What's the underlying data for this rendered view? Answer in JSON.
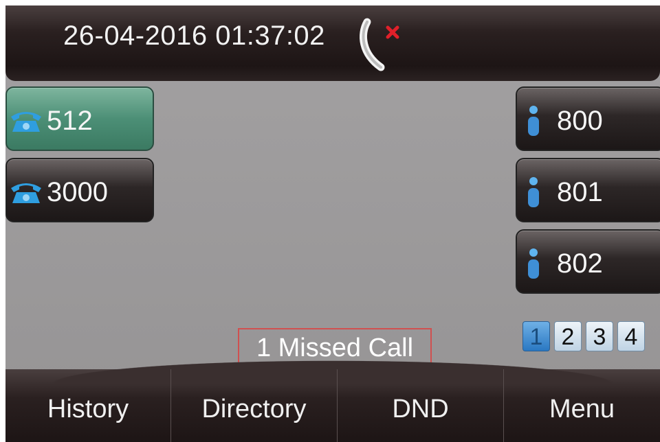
{
  "status_bar": {
    "datetime": "26-04-2016 01:37:02",
    "missed_call_icon": "missed-call-icon",
    "colors": {
      "missed_x": "#e0202a"
    }
  },
  "line_keys": [
    {
      "label": "512",
      "icon": "desk-phone-icon",
      "active": true
    },
    {
      "label": "3000",
      "icon": "desk-phone-icon",
      "active": false
    }
  ],
  "dss_keys": [
    {
      "label": "800",
      "icon": "contact-icon"
    },
    {
      "label": "801",
      "icon": "contact-icon"
    },
    {
      "label": "802",
      "icon": "contact-icon"
    }
  ],
  "pager": {
    "pages": [
      "1",
      "2",
      "3",
      "4"
    ],
    "current": "1"
  },
  "notification": {
    "text": "1 Missed Call"
  },
  "softkeys": {
    "history": "History",
    "directory": "Directory",
    "dnd": "DND",
    "menu": "Menu"
  },
  "colors": {
    "active_line": "#4c8f76",
    "accent_blue": "#2a78c2"
  }
}
